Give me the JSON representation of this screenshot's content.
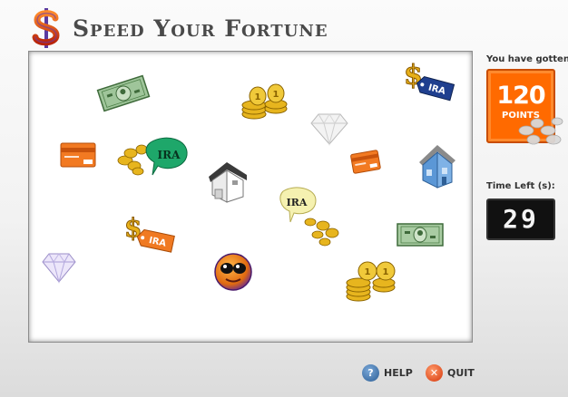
{
  "app": {
    "title": "Speed Your Fortune",
    "logo_icon": "dollar-logo-icon"
  },
  "score": {
    "label": "You have gotten:",
    "value": "120",
    "unit": "POINTS"
  },
  "timer": {
    "label": "Time Left (s):",
    "value": "29"
  },
  "buttons": {
    "help": "HELP",
    "quit": "QUIT"
  },
  "board": {
    "items": [
      {
        "type": "cash-bill"
      },
      {
        "type": "coin-stack"
      },
      {
        "type": "dollar-ira-tag",
        "text": "IRA",
        "color": "#1f3f8f"
      },
      {
        "type": "diamond"
      },
      {
        "type": "credit-card"
      },
      {
        "type": "coins-ira-bubble",
        "text": "IRA",
        "color": "#1ea76a"
      },
      {
        "type": "house"
      },
      {
        "type": "credit-card"
      },
      {
        "type": "blue-house"
      },
      {
        "type": "coins-ira-bubble",
        "text": "IRA",
        "color": "#f5f1b0"
      },
      {
        "type": "dollar-ira-tag",
        "text": "IRA",
        "color": "#f07a22"
      },
      {
        "type": "cash-bill"
      },
      {
        "type": "diamond-purple"
      },
      {
        "type": "player-face"
      },
      {
        "type": "coin-stack"
      }
    ]
  },
  "colors": {
    "score_bg": "#ff6a00",
    "timer_bg": "#111111",
    "board_bg": "#ffffff"
  }
}
